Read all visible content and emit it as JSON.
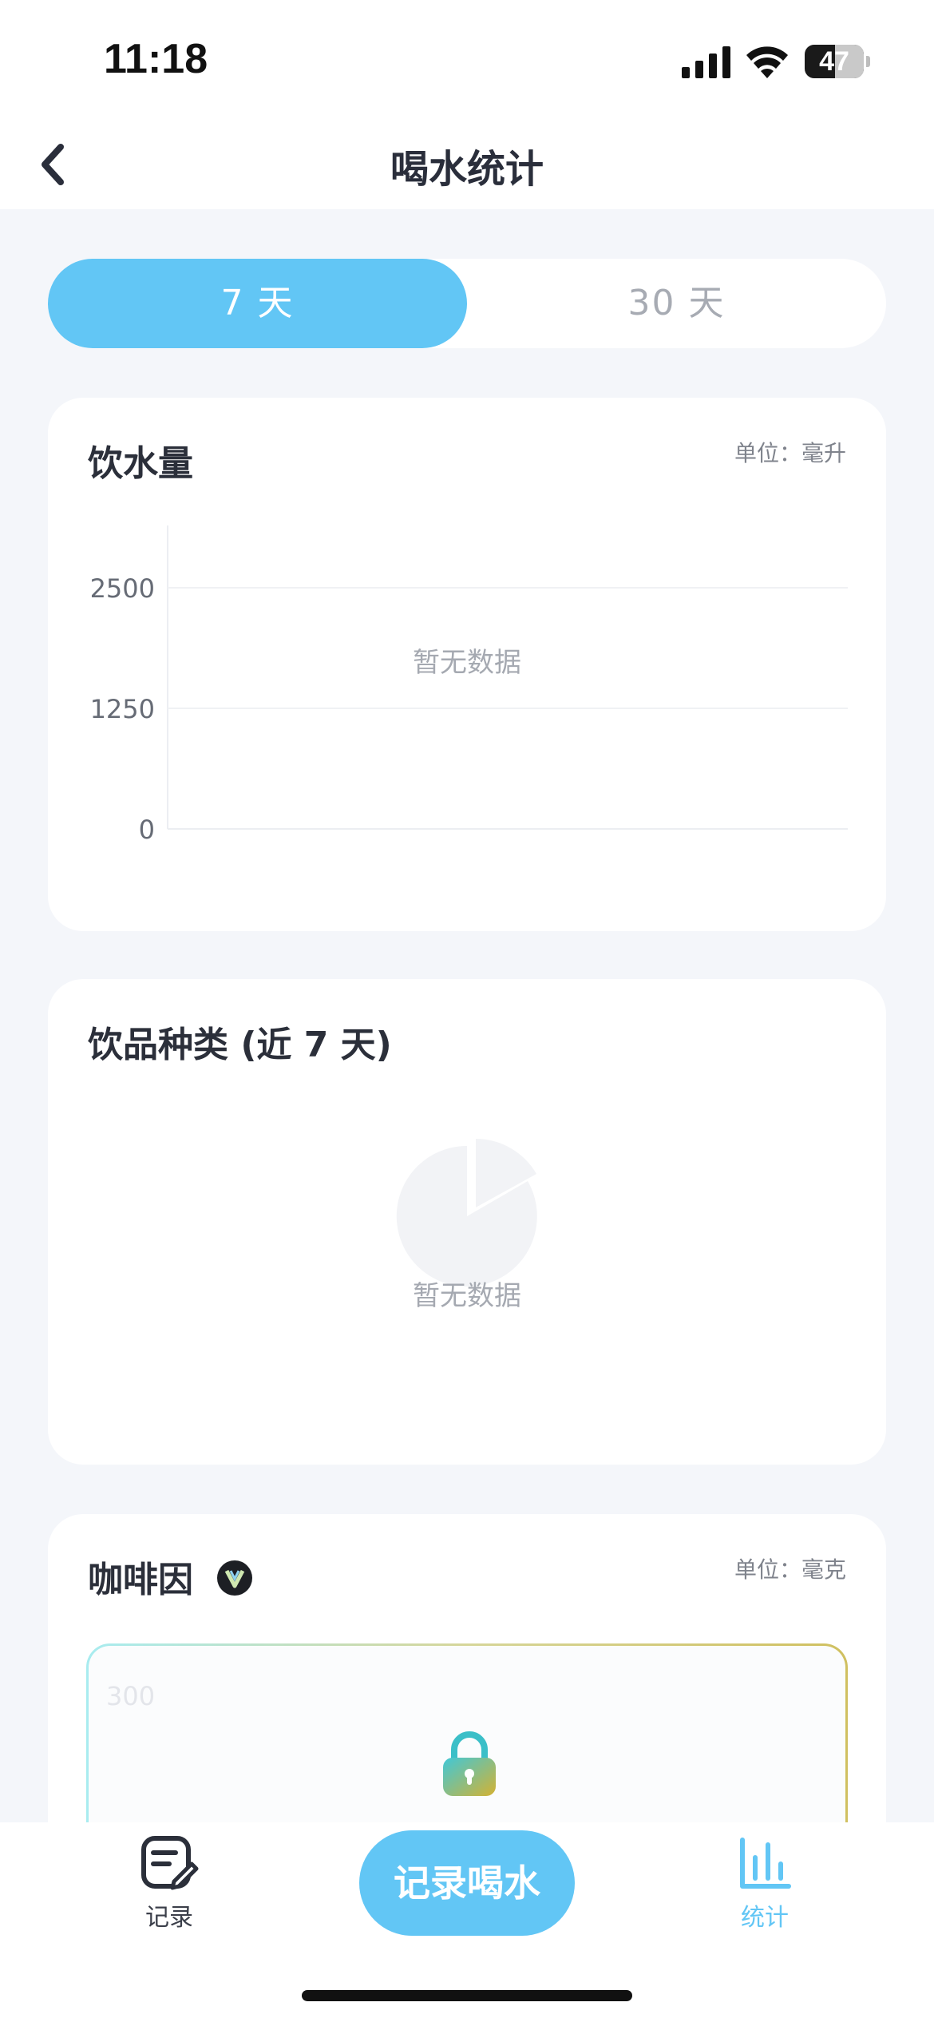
{
  "status_bar": {
    "time": "11:18",
    "battery": "47"
  },
  "nav": {
    "title": "喝水统计"
  },
  "range_tabs": [
    {
      "label": "7 天",
      "active": true
    },
    {
      "label": "30 天",
      "active": false
    }
  ],
  "water_card": {
    "title": "饮水量",
    "unit": "单位：毫升",
    "empty_text": "暂无数据",
    "y_ticks": [
      "2500",
      "1250",
      "0"
    ]
  },
  "drink_types_card": {
    "title": "饮品种类 (近 7 天)",
    "empty_text": "暂无数据"
  },
  "caffeine_card": {
    "title": "咖啡因",
    "unit": "单位：毫克",
    "locked_ticks": [
      "300"
    ]
  },
  "tab_bar": {
    "record_label": "记录",
    "record_water_label": "记录喝水",
    "stats_label": "统计"
  },
  "colors": {
    "accent": "#62c6f5",
    "background": "#f4f6fa",
    "card": "#ffffff",
    "muted_text": "#a5a9b1"
  },
  "chart_data": {
    "type": "bar",
    "categories": [],
    "values": [],
    "title": "饮水量",
    "ylim": [
      0,
      2500
    ],
    "yticks": [
      0,
      1250,
      2500
    ],
    "grid": true,
    "empty_text": "暂无数据"
  }
}
